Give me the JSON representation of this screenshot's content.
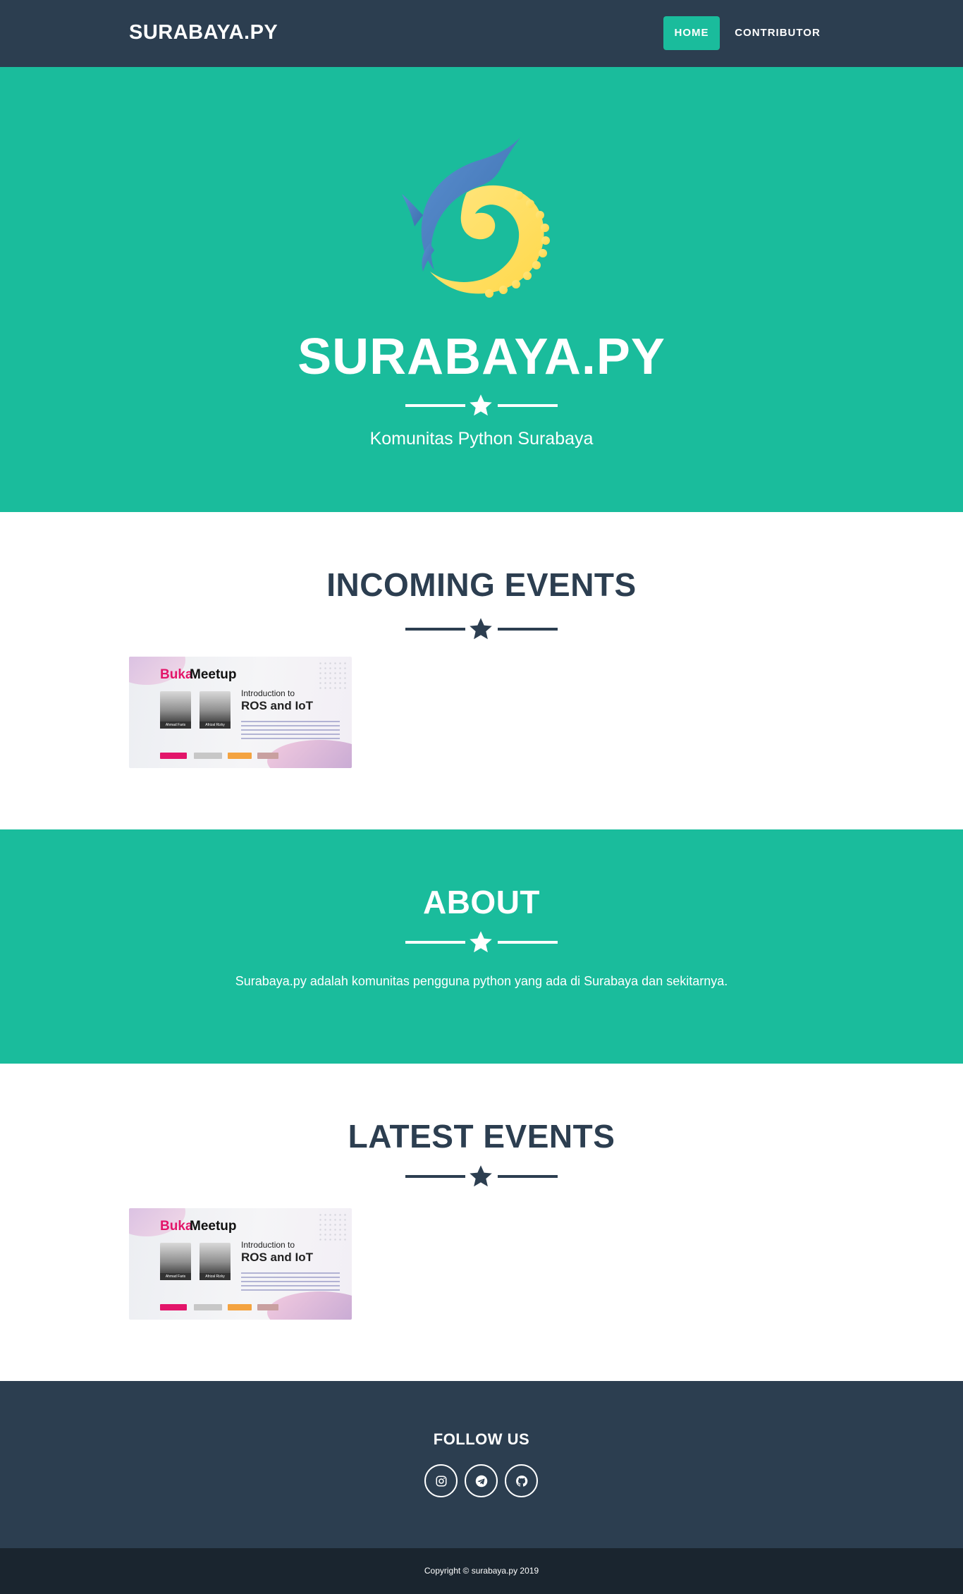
{
  "navbar": {
    "brand": "SURABAYA.PY",
    "links": [
      {
        "label": "HOME",
        "active": true
      },
      {
        "label": "CONTRIBUTOR",
        "active": false
      }
    ]
  },
  "masthead": {
    "logo_icon": "python-snake-logo",
    "heading": "SURABAYA.PY",
    "subheading": "Komunitas Python Surabaya"
  },
  "incoming_events": {
    "heading": "INCOMING EVENTS",
    "events": [
      {
        "poster": {
          "brand_buka": "Buka",
          "brand_meetup": "Meetup",
          "intro": "Introduction to",
          "topic": "ROS and IoT",
          "speaker_1": "Ahmad Faris",
          "speaker_2": "Afrizal Rizky"
        }
      }
    ]
  },
  "about": {
    "heading": "ABOUT",
    "text": "Surabaya.py adalah komunitas pengguna python yang ada di Surabaya dan sekitarnya."
  },
  "latest_events": {
    "heading": "LATEST EVENTS",
    "events": [
      {
        "poster": {
          "brand_buka": "Buka",
          "brand_meetup": "Meetup",
          "intro": "Introduction to",
          "topic": "ROS and IoT",
          "speaker_1": "Ahmad Faris",
          "speaker_2": "Afrizal Rizky"
        }
      }
    ]
  },
  "footer": {
    "heading": "FOLLOW US",
    "social": [
      {
        "icon": "instagram-icon"
      },
      {
        "icon": "telegram-icon"
      },
      {
        "icon": "github-icon"
      }
    ],
    "copyright": "Copyright © surabaya.py 2019"
  },
  "colors": {
    "primary": "#1abc9c",
    "secondary": "#2c3e50",
    "dark": "#1a252f",
    "logo_blue": "#4a7fc0",
    "logo_yellow": "#ffe066"
  }
}
